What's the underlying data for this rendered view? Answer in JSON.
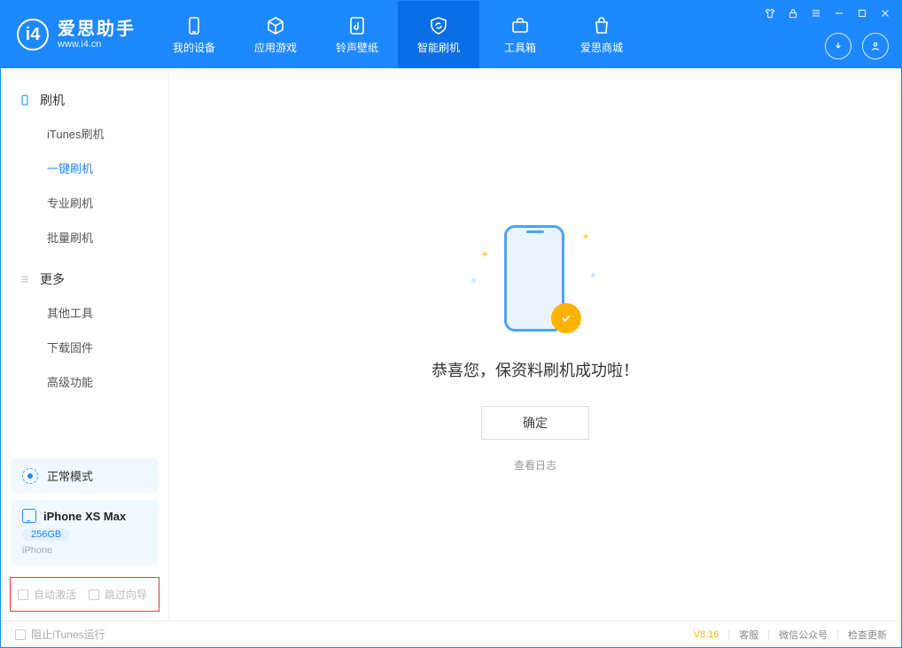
{
  "app": {
    "title": "爱思助手",
    "subtitle": "www.i4.cn"
  },
  "nav": {
    "device": "我的设备",
    "apps": "应用游戏",
    "ringtone": "铃声壁纸",
    "flash": "智能刷机",
    "toolbox": "工具箱",
    "store": "爱思商城"
  },
  "sidebar": {
    "flash_header": "刷机",
    "items": {
      "itunes": "iTunes刷机",
      "oneclick": "一键刷机",
      "pro": "专业刷机",
      "batch": "批量刷机"
    },
    "more_header": "更多",
    "more_items": {
      "other": "其他工具",
      "firmware": "下载固件",
      "advanced": "高级功能"
    }
  },
  "mode": {
    "label": "正常模式"
  },
  "device": {
    "name": "iPhone XS Max",
    "storage": "256GB",
    "type": "iPhone"
  },
  "options": {
    "auto_activate": "自动激活",
    "skip_guide": "跳过向导"
  },
  "main": {
    "success_message": "恭喜您，保资料刷机成功啦！",
    "ok_button": "确定",
    "view_log": "查看日志"
  },
  "footer": {
    "block_itunes": "阻止iTunes运行",
    "version": "V8.16",
    "support": "客服",
    "wechat": "微信公众号",
    "update": "检查更新"
  }
}
